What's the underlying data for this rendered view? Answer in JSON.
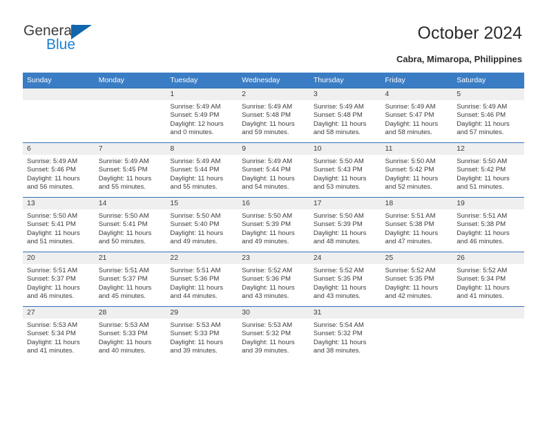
{
  "brand": {
    "name_top": "General",
    "name_bottom": "Blue",
    "triangle_color": "#1065ac",
    "blue_color": "#1d7fd3"
  },
  "header": {
    "title": "October 2024",
    "subtitle": "Cabra, Mimaropa, Philippines"
  },
  "theme": {
    "header_row_bg": "#3b7dc4",
    "row_border": "#2f6fb3",
    "daynum_bg": "#efefef",
    "text": "#3b3b3b"
  },
  "weekday_headers": [
    "Sunday",
    "Monday",
    "Tuesday",
    "Wednesday",
    "Thursday",
    "Friday",
    "Saturday"
  ],
  "labels": {
    "sunrise_prefix": "Sunrise:",
    "sunset_prefix": "Sunset:",
    "daylight_prefix": "Daylight:"
  },
  "weeks": [
    [
      {
        "day": "",
        "l1": "",
        "l2": "",
        "l3": "",
        "l4": ""
      },
      {
        "day": "",
        "l1": "",
        "l2": "",
        "l3": "",
        "l4": ""
      },
      {
        "day": "1",
        "l1": "Sunrise: 5:49 AM",
        "l2": "Sunset: 5:49 PM",
        "l3": "Daylight: 12 hours",
        "l4": "and 0 minutes."
      },
      {
        "day": "2",
        "l1": "Sunrise: 5:49 AM",
        "l2": "Sunset: 5:48 PM",
        "l3": "Daylight: 11 hours",
        "l4": "and 59 minutes."
      },
      {
        "day": "3",
        "l1": "Sunrise: 5:49 AM",
        "l2": "Sunset: 5:48 PM",
        "l3": "Daylight: 11 hours",
        "l4": "and 58 minutes."
      },
      {
        "day": "4",
        "l1": "Sunrise: 5:49 AM",
        "l2": "Sunset: 5:47 PM",
        "l3": "Daylight: 11 hours",
        "l4": "and 58 minutes."
      },
      {
        "day": "5",
        "l1": "Sunrise: 5:49 AM",
        "l2": "Sunset: 5:46 PM",
        "l3": "Daylight: 11 hours",
        "l4": "and 57 minutes."
      }
    ],
    [
      {
        "day": "6",
        "l1": "Sunrise: 5:49 AM",
        "l2": "Sunset: 5:46 PM",
        "l3": "Daylight: 11 hours",
        "l4": "and 56 minutes."
      },
      {
        "day": "7",
        "l1": "Sunrise: 5:49 AM",
        "l2": "Sunset: 5:45 PM",
        "l3": "Daylight: 11 hours",
        "l4": "and 55 minutes."
      },
      {
        "day": "8",
        "l1": "Sunrise: 5:49 AM",
        "l2": "Sunset: 5:44 PM",
        "l3": "Daylight: 11 hours",
        "l4": "and 55 minutes."
      },
      {
        "day": "9",
        "l1": "Sunrise: 5:49 AM",
        "l2": "Sunset: 5:44 PM",
        "l3": "Daylight: 11 hours",
        "l4": "and 54 minutes."
      },
      {
        "day": "10",
        "l1": "Sunrise: 5:50 AM",
        "l2": "Sunset: 5:43 PM",
        "l3": "Daylight: 11 hours",
        "l4": "and 53 minutes."
      },
      {
        "day": "11",
        "l1": "Sunrise: 5:50 AM",
        "l2": "Sunset: 5:42 PM",
        "l3": "Daylight: 11 hours",
        "l4": "and 52 minutes."
      },
      {
        "day": "12",
        "l1": "Sunrise: 5:50 AM",
        "l2": "Sunset: 5:42 PM",
        "l3": "Daylight: 11 hours",
        "l4": "and 51 minutes."
      }
    ],
    [
      {
        "day": "13",
        "l1": "Sunrise: 5:50 AM",
        "l2": "Sunset: 5:41 PM",
        "l3": "Daylight: 11 hours",
        "l4": "and 51 minutes."
      },
      {
        "day": "14",
        "l1": "Sunrise: 5:50 AM",
        "l2": "Sunset: 5:41 PM",
        "l3": "Daylight: 11 hours",
        "l4": "and 50 minutes."
      },
      {
        "day": "15",
        "l1": "Sunrise: 5:50 AM",
        "l2": "Sunset: 5:40 PM",
        "l3": "Daylight: 11 hours",
        "l4": "and 49 minutes."
      },
      {
        "day": "16",
        "l1": "Sunrise: 5:50 AM",
        "l2": "Sunset: 5:39 PM",
        "l3": "Daylight: 11 hours",
        "l4": "and 49 minutes."
      },
      {
        "day": "17",
        "l1": "Sunrise: 5:50 AM",
        "l2": "Sunset: 5:39 PM",
        "l3": "Daylight: 11 hours",
        "l4": "and 48 minutes."
      },
      {
        "day": "18",
        "l1": "Sunrise: 5:51 AM",
        "l2": "Sunset: 5:38 PM",
        "l3": "Daylight: 11 hours",
        "l4": "and 47 minutes."
      },
      {
        "day": "19",
        "l1": "Sunrise: 5:51 AM",
        "l2": "Sunset: 5:38 PM",
        "l3": "Daylight: 11 hours",
        "l4": "and 46 minutes."
      }
    ],
    [
      {
        "day": "20",
        "l1": "Sunrise: 5:51 AM",
        "l2": "Sunset: 5:37 PM",
        "l3": "Daylight: 11 hours",
        "l4": "and 46 minutes."
      },
      {
        "day": "21",
        "l1": "Sunrise: 5:51 AM",
        "l2": "Sunset: 5:37 PM",
        "l3": "Daylight: 11 hours",
        "l4": "and 45 minutes."
      },
      {
        "day": "22",
        "l1": "Sunrise: 5:51 AM",
        "l2": "Sunset: 5:36 PM",
        "l3": "Daylight: 11 hours",
        "l4": "and 44 minutes."
      },
      {
        "day": "23",
        "l1": "Sunrise: 5:52 AM",
        "l2": "Sunset: 5:36 PM",
        "l3": "Daylight: 11 hours",
        "l4": "and 43 minutes."
      },
      {
        "day": "24",
        "l1": "Sunrise: 5:52 AM",
        "l2": "Sunset: 5:35 PM",
        "l3": "Daylight: 11 hours",
        "l4": "and 43 minutes."
      },
      {
        "day": "25",
        "l1": "Sunrise: 5:52 AM",
        "l2": "Sunset: 5:35 PM",
        "l3": "Daylight: 11 hours",
        "l4": "and 42 minutes."
      },
      {
        "day": "26",
        "l1": "Sunrise: 5:52 AM",
        "l2": "Sunset: 5:34 PM",
        "l3": "Daylight: 11 hours",
        "l4": "and 41 minutes."
      }
    ],
    [
      {
        "day": "27",
        "l1": "Sunrise: 5:53 AM",
        "l2": "Sunset: 5:34 PM",
        "l3": "Daylight: 11 hours",
        "l4": "and 41 minutes."
      },
      {
        "day": "28",
        "l1": "Sunrise: 5:53 AM",
        "l2": "Sunset: 5:33 PM",
        "l3": "Daylight: 11 hours",
        "l4": "and 40 minutes."
      },
      {
        "day": "29",
        "l1": "Sunrise: 5:53 AM",
        "l2": "Sunset: 5:33 PM",
        "l3": "Daylight: 11 hours",
        "l4": "and 39 minutes."
      },
      {
        "day": "30",
        "l1": "Sunrise: 5:53 AM",
        "l2": "Sunset: 5:32 PM",
        "l3": "Daylight: 11 hours",
        "l4": "and 39 minutes."
      },
      {
        "day": "31",
        "l1": "Sunrise: 5:54 AM",
        "l2": "Sunset: 5:32 PM",
        "l3": "Daylight: 11 hours",
        "l4": "and 38 minutes."
      },
      {
        "day": "",
        "l1": "",
        "l2": "",
        "l3": "",
        "l4": ""
      },
      {
        "day": "",
        "l1": "",
        "l2": "",
        "l3": "",
        "l4": ""
      }
    ]
  ]
}
